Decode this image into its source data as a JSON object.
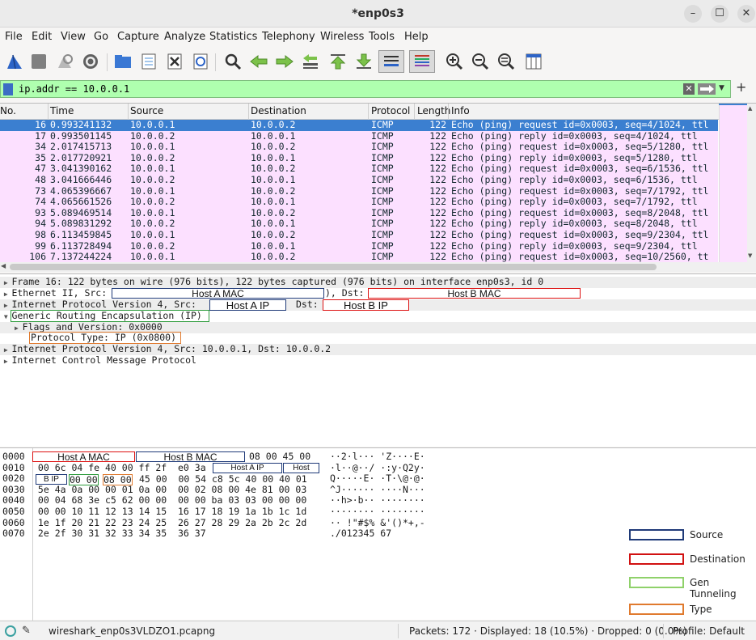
{
  "window": {
    "title": "*enp0s3"
  },
  "menu": [
    "File",
    "Edit",
    "View",
    "Go",
    "Capture",
    "Analyze",
    "Statistics",
    "Telephony",
    "Wireless",
    "Tools",
    "Help"
  ],
  "filter": {
    "value": "ip.addr == 10.0.0.1"
  },
  "columns": [
    "No.",
    "Time",
    "Source",
    "Destination",
    "Protocol",
    "Length",
    "Info"
  ],
  "packets": [
    {
      "no": "16",
      "time": "0.993241132",
      "src": "10.0.0.1",
      "dst": "10.0.0.2",
      "proto": "ICMP",
      "len": "122",
      "info": "Echo (ping) request  id=0x0003, seq=4/1024, ttl"
    },
    {
      "no": "17",
      "time": "0.993501145",
      "src": "10.0.0.2",
      "dst": "10.0.0.1",
      "proto": "ICMP",
      "len": "122",
      "info": "Echo (ping) reply    id=0x0003, seq=4/1024, ttl"
    },
    {
      "no": "34",
      "time": "2.017415713",
      "src": "10.0.0.1",
      "dst": "10.0.0.2",
      "proto": "ICMP",
      "len": "122",
      "info": "Echo (ping) request  id=0x0003, seq=5/1280, ttl"
    },
    {
      "no": "35",
      "time": "2.017720921",
      "src": "10.0.0.2",
      "dst": "10.0.0.1",
      "proto": "ICMP",
      "len": "122",
      "info": "Echo (ping) reply    id=0x0003, seq=5/1280, ttl"
    },
    {
      "no": "47",
      "time": "3.041390162",
      "src": "10.0.0.1",
      "dst": "10.0.0.2",
      "proto": "ICMP",
      "len": "122",
      "info": "Echo (ping) request  id=0x0003, seq=6/1536, ttl"
    },
    {
      "no": "48",
      "time": "3.041666446",
      "src": "10.0.0.2",
      "dst": "10.0.0.1",
      "proto": "ICMP",
      "len": "122",
      "info": "Echo (ping) reply    id=0x0003, seq=6/1536, ttl"
    },
    {
      "no": "73",
      "time": "4.065396667",
      "src": "10.0.0.1",
      "dst": "10.0.0.2",
      "proto": "ICMP",
      "len": "122",
      "info": "Echo (ping) request  id=0x0003, seq=7/1792, ttl"
    },
    {
      "no": "74",
      "time": "4.065661526",
      "src": "10.0.0.2",
      "dst": "10.0.0.1",
      "proto": "ICMP",
      "len": "122",
      "info": "Echo (ping) reply    id=0x0003, seq=7/1792, ttl"
    },
    {
      "no": "93",
      "time": "5.089469514",
      "src": "10.0.0.1",
      "dst": "10.0.0.2",
      "proto": "ICMP",
      "len": "122",
      "info": "Echo (ping) request  id=0x0003, seq=8/2048, ttl"
    },
    {
      "no": "94",
      "time": "5.089831292",
      "src": "10.0.0.2",
      "dst": "10.0.0.1",
      "proto": "ICMP",
      "len": "122",
      "info": "Echo (ping) reply    id=0x0003, seq=8/2048, ttl"
    },
    {
      "no": "98",
      "time": "6.113459845",
      "src": "10.0.0.1",
      "dst": "10.0.0.2",
      "proto": "ICMP",
      "len": "122",
      "info": "Echo (ping) request  id=0x0003, seq=9/2304, ttl"
    },
    {
      "no": "99",
      "time": "6.113728494",
      "src": "10.0.0.2",
      "dst": "10.0.0.1",
      "proto": "ICMP",
      "len": "122",
      "info": "Echo (ping) reply    id=0x0003, seq=9/2304, ttl"
    },
    {
      "no": "106",
      "time": "7.137244224",
      "src": "10.0.0.1",
      "dst": "10.0.0.2",
      "proto": "ICMP",
      "len": "122",
      "info": "Echo (ping) request  id=0x0003, seq=10/2560, tt"
    }
  ],
  "details": {
    "frame": "Frame 16: 122 bytes on wire (976 bits), 122 bytes captured (976 bits) on interface enp0s3, id 0",
    "eth_prefix": "Ethernet II, Src:",
    "eth_mid": "), Dst:",
    "ip_prefix": "Internet Protocol Version 4, Src:",
    "ip_mid": "Dst:",
    "gre": "Generic Routing Encapsulation (IP)",
    "flags": "Flags and Version: 0x0000",
    "proto_type": "Protocol Type: IP (0x0800)",
    "ip_inner": "Internet Protocol Version 4, Src: 10.0.0.1, Dst: 10.0.0.2",
    "icmp": "Internet Control Message Protocol"
  },
  "annotations": {
    "host_a_mac": "Host A MAC",
    "host_b_mac": "Host B MAC",
    "host_a_ip": "Host A IP",
    "host_b_ip": "Host B IP",
    "bytes_host_a_mac": "Host A MAC",
    "bytes_host_b_mac": "Host B MAC",
    "bytes_host_a_ip": "Host A IP",
    "bytes_host": "Host",
    "bytes_b_ip": "B IP"
  },
  "bytes": {
    "offsets": [
      "0000",
      "0010",
      "0020",
      "0030",
      "0040",
      "0050",
      "0060",
      "0070"
    ],
    "hex": [
      "",
      " 00 6c 04 fe 40 00 ff 2f  e0 3a",
      "",
      " 5e 4a 0a 00 00 01 0a 00  00 02 08 00 4e 81 00 03",
      " 00 04 68 3e c5 62 00 00  00 00 ba 03 03 00 00 00",
      " 00 00 10 11 12 13 14 15  16 17 18 19 1a 1b 1c 1d",
      " 1e 1f 20 21 22 23 24 25  26 27 28 29 2a 2b 2c 2d",
      " 2e 2f 30 31 32 33 34 35  36 37"
    ],
    "hex0_tail": "08 00 45 00",
    "hex2_a": "00 00",
    "hex2_b": "08 00",
    "hex2_c": "45 00  00 54 c8 5c 40 00 40 01",
    "ascii": [
      "··2·l··· 'Z····E·",
      "·l··@··/ ·:y·Q2y·",
      "Q·····E· ·T·\\@·@·",
      "^J······ ····N···",
      "··h>·b·· ········",
      "········ ········",
      "·· !\"#$% &'()*+,-",
      "./012345 67"
    ]
  },
  "legend": [
    {
      "label": "Source",
      "color": "#1f3a78"
    },
    {
      "label": "Destination",
      "color": "#d11111"
    },
    {
      "label": "Gen Tunneling",
      "color": "#8fd16a"
    },
    {
      "label": "Type",
      "color": "#e07a2e"
    }
  ],
  "status": {
    "file": "wireshark_enp0s3VLDZO1.pcapng",
    "packets": "Packets: 172 · Displayed: 18 (10.5%) · Dropped: 0 (0.0%)",
    "profile": "Profile: Default"
  }
}
